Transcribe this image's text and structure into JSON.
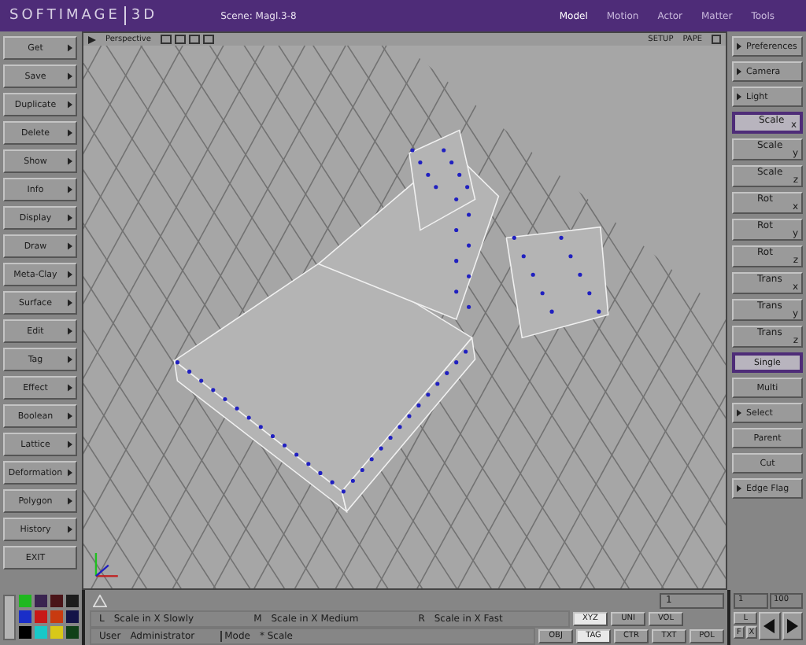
{
  "title_bar": {
    "logo": "SOFTIMAGE",
    "logo_suffix": "3D",
    "scene": "Scene: Magl.3-8",
    "modules": [
      {
        "label": "Model",
        "selected": true
      },
      {
        "label": "Motion",
        "selected": false
      },
      {
        "label": "Actor",
        "selected": false
      },
      {
        "label": "Matter",
        "selected": false
      },
      {
        "label": "Tools",
        "selected": false
      }
    ]
  },
  "left_menu": [
    {
      "label": "Get",
      "arrow": true
    },
    {
      "label": "Save",
      "arrow": true
    },
    {
      "label": "Duplicate",
      "arrow": true
    },
    {
      "label": "Delete",
      "arrow": true
    },
    {
      "label": "Show",
      "arrow": true
    },
    {
      "label": "Info",
      "arrow": true
    },
    {
      "label": "Display",
      "arrow": true
    },
    {
      "label": "Draw",
      "arrow": true
    },
    {
      "label": "Meta-Clay",
      "arrow": true
    },
    {
      "label": "Surface",
      "arrow": true
    },
    {
      "label": "Edit",
      "arrow": true
    },
    {
      "label": "Tag",
      "arrow": true
    },
    {
      "label": "Effect",
      "arrow": true
    },
    {
      "label": "Boolean",
      "arrow": true
    },
    {
      "label": "Lattice",
      "arrow": true
    },
    {
      "label": "Deformation",
      "arrow": true
    },
    {
      "label": "Polygon",
      "arrow": true
    },
    {
      "label": "History",
      "arrow": true
    },
    {
      "label": "EXIT",
      "arrow": false
    }
  ],
  "viewport": {
    "label": "Perspective",
    "setup": "SETUP",
    "mode": "PAPE"
  },
  "right_menu": [
    {
      "kind": "menu",
      "label": "Preferences",
      "selected": false
    },
    {
      "kind": "menu",
      "label": "Camera",
      "selected": false
    },
    {
      "kind": "menu",
      "label": "Light",
      "selected": false
    },
    {
      "kind": "axis",
      "label": "Scale",
      "axis": "x",
      "selected": true
    },
    {
      "kind": "axis",
      "label": "Scale",
      "axis": "y",
      "selected": false
    },
    {
      "kind": "axis",
      "label": "Scale",
      "axis": "z",
      "selected": false
    },
    {
      "kind": "axis",
      "label": "Rot",
      "axis": "x",
      "selected": false
    },
    {
      "kind": "axis",
      "label": "Rot",
      "axis": "y",
      "selected": false
    },
    {
      "kind": "axis",
      "label": "Rot",
      "axis": "z",
      "selected": false
    },
    {
      "kind": "axis",
      "label": "Trans",
      "axis": "x",
      "selected": false
    },
    {
      "kind": "axis",
      "label": "Trans",
      "axis": "y",
      "selected": false
    },
    {
      "kind": "axis",
      "label": "Trans",
      "axis": "z",
      "selected": false
    },
    {
      "kind": "button",
      "label": "Single",
      "selected": true
    },
    {
      "kind": "button",
      "label": "Multi",
      "selected": false
    },
    {
      "kind": "menu",
      "label": "Select",
      "selected": false
    },
    {
      "kind": "button",
      "label": "Parent",
      "selected": false
    },
    {
      "kind": "button",
      "label": "Cut",
      "selected": false
    },
    {
      "kind": "menu",
      "label": "Edge Flag",
      "selected": false
    }
  ],
  "palette": [
    {
      "color": "#1fb81f"
    },
    {
      "color": "#3a2450"
    },
    {
      "color": "#4a1418"
    },
    {
      "color": "#1c1c1c"
    },
    {
      "color": "#1a2ec8"
    },
    {
      "color": "#c81818"
    },
    {
      "color": "#c83a10"
    },
    {
      "color": "#141448"
    },
    {
      "color": "#000000"
    },
    {
      "color": "#18c8c8"
    },
    {
      "color": "#d8c818"
    },
    {
      "color": "#104018"
    }
  ],
  "status": {
    "prompt_value": "1",
    "mouse": [
      {
        "key": "L",
        "text": "Scale in X Slowly"
      },
      {
        "key": "M",
        "text": "Scale in X Medium"
      },
      {
        "key": "R",
        "text": "Scale in X Fast"
      }
    ],
    "user_label": "User",
    "user": "Administrator",
    "mode_label": "Mode",
    "mode": "* Scale",
    "toggles_top": [
      {
        "label": "XYZ",
        "selected": true
      },
      {
        "label": "UNI",
        "selected": false
      },
      {
        "label": "VOL",
        "selected": false
      }
    ],
    "toggles_bottom": [
      {
        "label": "OBJ",
        "selected": false
      },
      {
        "label": "TAG",
        "selected": true
      },
      {
        "label": "CTR",
        "selected": false
      },
      {
        "label": "TXT",
        "selected": false
      },
      {
        "label": "POL",
        "selected": false
      }
    ]
  },
  "frames": {
    "start": "1",
    "end": "100",
    "key": "L",
    "flag_1": "F",
    "flag_2": "X"
  }
}
